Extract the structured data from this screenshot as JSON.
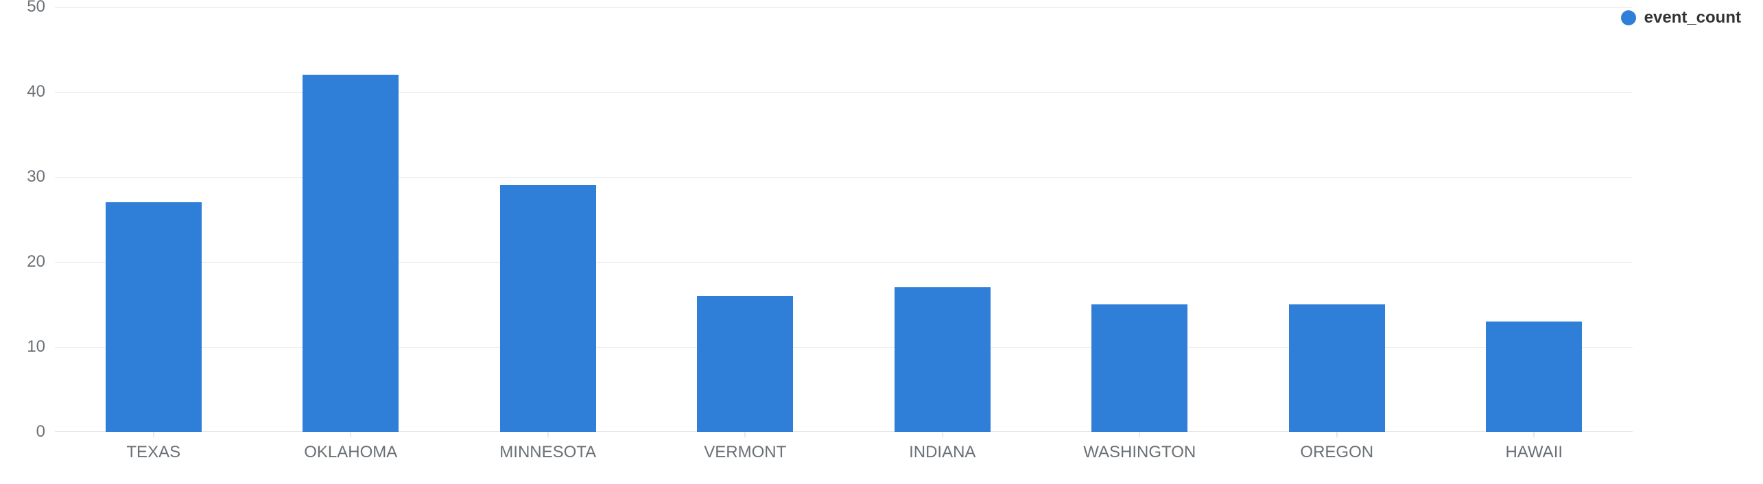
{
  "chart_data": {
    "type": "bar",
    "title": "",
    "xlabel": "",
    "ylabel": "",
    "ylim": [
      0,
      50
    ],
    "yticks": [
      0,
      10,
      20,
      30,
      40,
      50
    ],
    "categories": [
      "TEXAS",
      "OKLAHOMA",
      "MINNESOTA",
      "VERMONT",
      "INDIANA",
      "WASHINGTON",
      "OREGON",
      "HAWAII"
    ],
    "series": [
      {
        "name": "event_count",
        "values": [
          27,
          42,
          29,
          16,
          17,
          15,
          15,
          13
        ]
      }
    ],
    "legend_position": "top-right",
    "grid": true,
    "color": "#2f7ed8"
  }
}
